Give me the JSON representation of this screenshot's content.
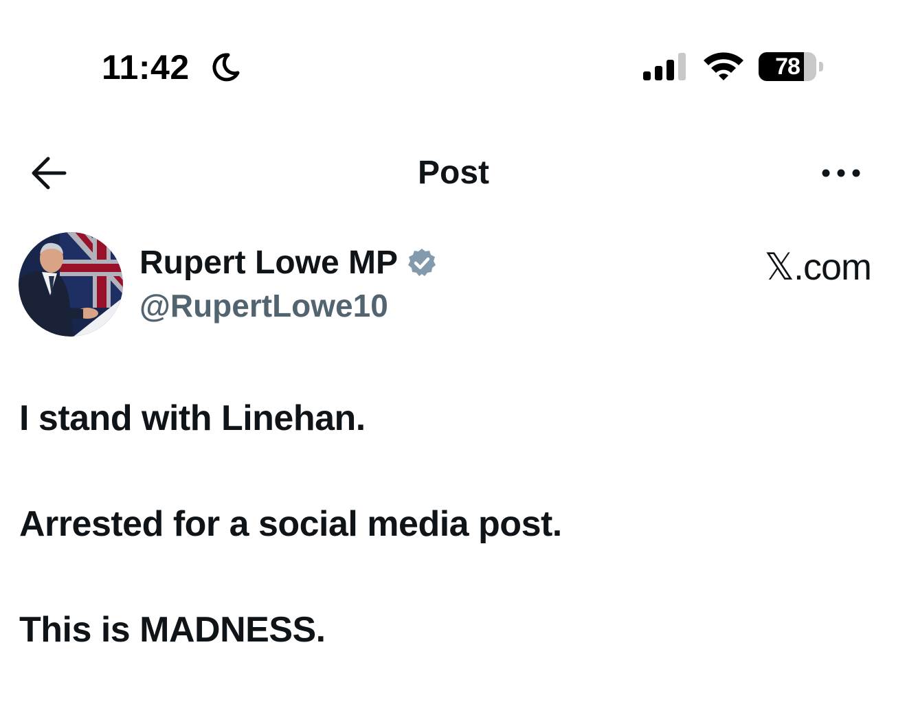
{
  "status_bar": {
    "time": "11:42",
    "battery_level": 78,
    "battery_text": "78",
    "focus_icon": "moon-icon",
    "signal_icon": "cellular-signal-icon",
    "wifi_icon": "wifi-icon"
  },
  "header": {
    "title": "Post",
    "back_icon": "back-arrow-icon",
    "more_icon": "more-icon"
  },
  "author": {
    "name": "Rupert Lowe MP",
    "handle": "@RupertLowe10",
    "verified_color": "#829aab",
    "source": "𝕏.com"
  },
  "post": {
    "lines": [
      "I stand with Linehan.",
      "Arrested for a social media post.",
      "This is MADNESS."
    ]
  },
  "colors": {
    "text_primary": "#0f1419",
    "text_secondary": "#536471",
    "background": "#ffffff"
  }
}
